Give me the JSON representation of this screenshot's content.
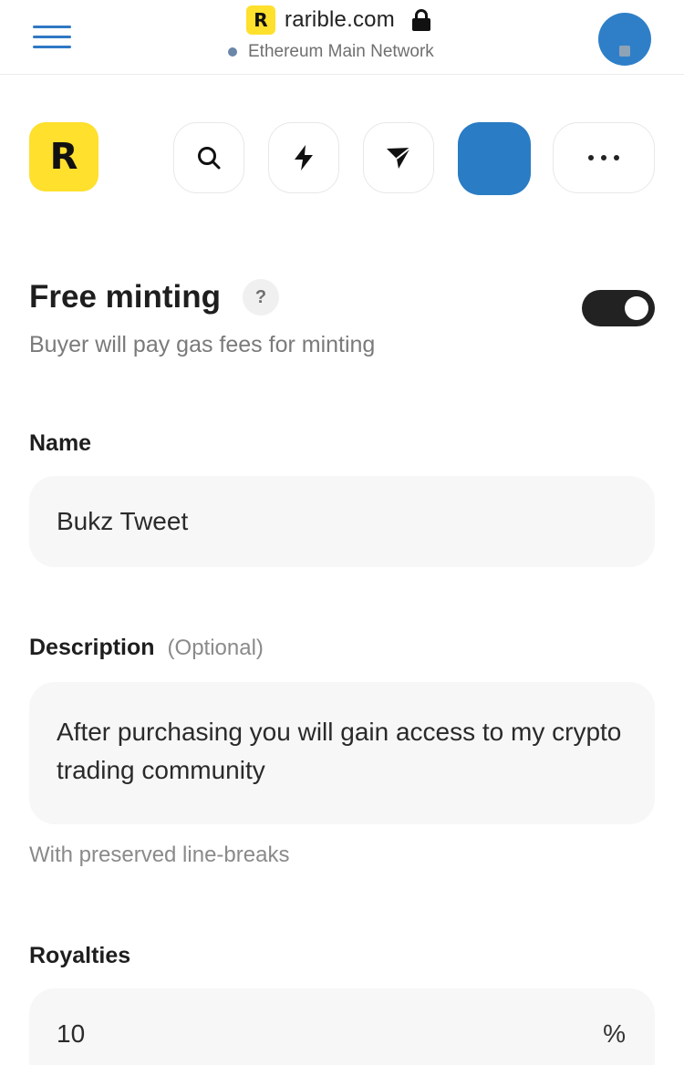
{
  "browser": {
    "site_logo_letter": "R",
    "url": "rarible.com",
    "network": "Ethereum Main Network"
  },
  "toolbar": {
    "logo_letter": "R",
    "icons": [
      "search-icon",
      "lightning-icon",
      "send-icon",
      "profile-tile",
      "more-icon"
    ]
  },
  "free_minting": {
    "title": "Free minting",
    "help": "?",
    "subtitle": "Buyer will pay gas fees for minting",
    "enabled": true
  },
  "name": {
    "label": "Name",
    "value": "Bukz Tweet"
  },
  "description": {
    "label": "Description",
    "optional": "(Optional)",
    "value": "After purchasing you will gain access to my crypto trading community",
    "hint": "With preserved line-breaks"
  },
  "royalties": {
    "label": "Royalties",
    "value": "10",
    "suffix": "%"
  },
  "colors": {
    "brand_yellow": "#fee02d",
    "accent_blue": "#2f78c4",
    "toggle_on": "#222222"
  }
}
